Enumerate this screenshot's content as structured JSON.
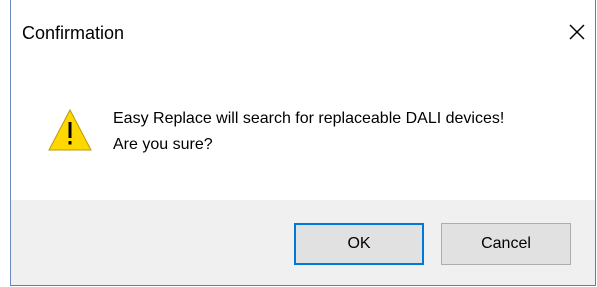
{
  "dialog": {
    "title": "Confirmation",
    "close_icon": "close-icon",
    "message_line1": "Easy Replace will search for replaceable DALI devices!",
    "message_line2": "Are you sure?",
    "icon": "warning-icon",
    "ok_label": "OK",
    "cancel_label": "Cancel"
  },
  "colors": {
    "warning_fill": "#ffd800",
    "default_button_border": "#0078d7",
    "footer_background": "#f0f0f0"
  }
}
